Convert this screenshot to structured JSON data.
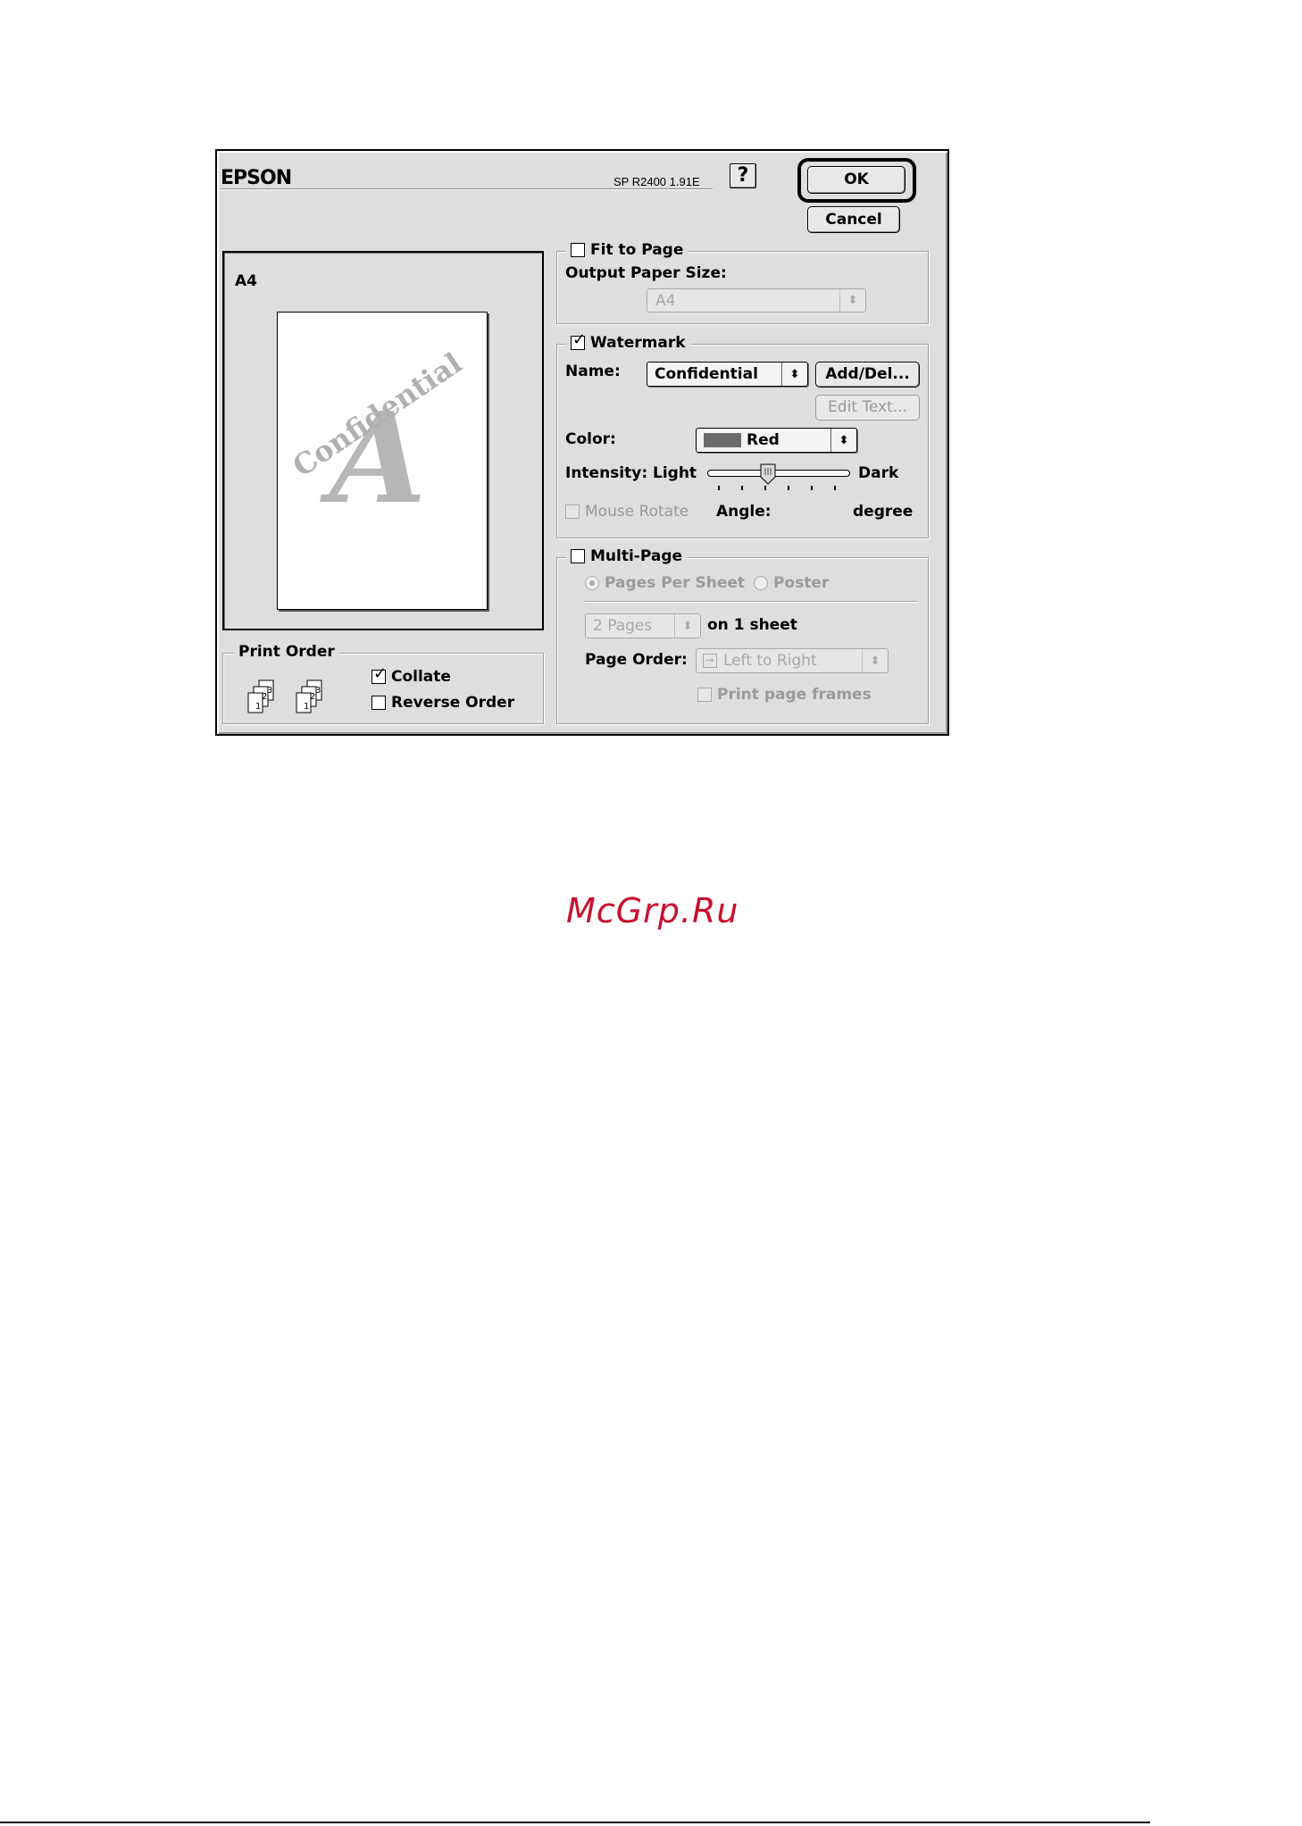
{
  "brand": {
    "logo": "EPSON",
    "version": "SP R2400 1.91E"
  },
  "help_icon": "?",
  "buttons": {
    "ok": "OK",
    "cancel": "Cancel",
    "add_del": "Add/Del...",
    "edit_text": "Edit Text..."
  },
  "preview": {
    "paper_label": "A4",
    "watermark_text": "Confidential",
    "watermark_letter": "A"
  },
  "fit_to_page": {
    "label": "Fit to Page",
    "checked": false,
    "output_label": "Output Paper Size:",
    "output_value": "A4"
  },
  "watermark": {
    "label": "Watermark",
    "checked": true,
    "name_label": "Name:",
    "name_value": "Confidential",
    "color_label": "Color:",
    "color_value": "Red",
    "color_swatch": "#6b6b6b",
    "intensity_label": "Intensity:",
    "light_label": "Light",
    "dark_label": "Dark",
    "intensity_level": 0.42,
    "mouse_rotate_label": "Mouse Rotate",
    "angle_label": "Angle:",
    "degree_label": "degree"
  },
  "multi_page": {
    "label": "Multi-Page",
    "checked": false,
    "pages_per_sheet": "Pages Per Sheet",
    "poster": "Poster",
    "pages_value": "2 Pages",
    "on_sheet": "on 1 sheet",
    "page_order_label": "Page Order:",
    "page_order_value": "Left to Right",
    "print_frames": "Print page frames"
  },
  "print_order": {
    "label": "Print Order",
    "collate": "Collate",
    "collate_checked": true,
    "reverse": "Reverse Order",
    "reverse_checked": false
  },
  "footer_watermark": "McGrp.Ru"
}
